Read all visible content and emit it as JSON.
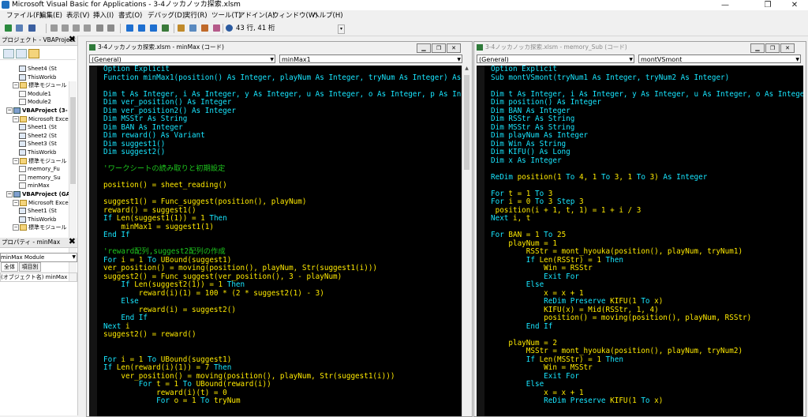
{
  "window": {
    "title": "Microsoft Visual Basic for Applications - 3-4ノッカノッカ探索.xlsm",
    "minimize": "—",
    "restore": "❐",
    "close": "✕"
  },
  "menu": [
    "ファイル(F)",
    "編集(E)",
    "表示(V)",
    "挿入(I)",
    "書式(O)",
    "デバッグ(D)",
    "実行(R)",
    "ツール(T)",
    "アドイン(A)",
    "ウィンドウ(W)",
    "ヘルプ(H)"
  ],
  "toolbar": {
    "cursor_pos": "43 行, 41 桁"
  },
  "project_pane": {
    "title": "プロジェクト - VBAProject",
    "close": "✖",
    "items": [
      {
        "label": "Sheet4 (St",
        "indent": 3,
        "icon": "sheet"
      },
      {
        "label": "ThisWorkb",
        "indent": 3,
        "icon": "sheet"
      },
      {
        "label": "標準モジュール",
        "indent": 2,
        "icon": "folder",
        "exp": "−"
      },
      {
        "label": "Module1",
        "indent": 3,
        "icon": "mod"
      },
      {
        "label": "Module2",
        "indent": 3,
        "icon": "mod"
      },
      {
        "label": "VBAProject (3-",
        "indent": 1,
        "icon": "proj",
        "exp": "−",
        "bold": true
      },
      {
        "label": "Microsoft Exce",
        "indent": 2,
        "icon": "folder",
        "exp": "−"
      },
      {
        "label": "Sheet1 (St",
        "indent": 3,
        "icon": "sheet"
      },
      {
        "label": "Sheet2 (St",
        "indent": 3,
        "icon": "sheet"
      },
      {
        "label": "Sheet3 (St",
        "indent": 3,
        "icon": "sheet"
      },
      {
        "label": "ThisWorkb",
        "indent": 3,
        "icon": "sheet"
      },
      {
        "label": "標準モジュール",
        "indent": 2,
        "icon": "folder",
        "exp": "−"
      },
      {
        "label": "memory_Fu",
        "indent": 3,
        "icon": "mod"
      },
      {
        "label": "memory_Su",
        "indent": 3,
        "icon": "mod"
      },
      {
        "label": "minMax",
        "indent": 3,
        "icon": "mod"
      },
      {
        "label": "VBAProject (GA",
        "indent": 1,
        "icon": "proj",
        "exp": "−",
        "bold": true
      },
      {
        "label": "Microsoft Exce",
        "indent": 2,
        "icon": "folder",
        "exp": "−"
      },
      {
        "label": "Sheet1 (St",
        "indent": 3,
        "icon": "sheet"
      },
      {
        "label": "ThisWorkb",
        "indent": 3,
        "icon": "sheet"
      },
      {
        "label": "標準モジュール",
        "indent": 2,
        "icon": "folder",
        "exp": "−"
      }
    ]
  },
  "properties_pane": {
    "title": "プロパティ - minMax",
    "close": "✖",
    "object": "minMax Module",
    "tab_all": "全体",
    "tab_category": "項目別",
    "row": "(オブジェクト名) minMax"
  },
  "code_window_left": {
    "title": "3-4ノッカノッカ探索.xlsm - minMax (コード)",
    "object_combo": "(General)",
    "proc_combo": "minMax1",
    "lines": [
      [
        [
          "kw",
          "Option Explicit"
        ]
      ],
      [
        [
          "kw",
          "Function minMax1(position() As Integer, playNum As Integer, tryNum As Integer) As Str"
        ]
      ],
      [],
      [
        [
          "kw",
          "Dim t As Integer, i As Integer, y As Integer, u As Integer, o As Integer, p As Integ"
        ]
      ],
      [
        [
          "kw",
          "Dim ver_position() As Integer"
        ]
      ],
      [
        [
          "kw",
          "Dim ver_position2() As Integer"
        ]
      ],
      [
        [
          "kw",
          "Dim MSStr As String"
        ]
      ],
      [
        [
          "kw",
          "Dim BAN As Integer"
        ]
      ],
      [
        [
          "kw",
          "Dim reward() As Variant"
        ]
      ],
      [
        [
          "kw",
          "Dim suggest1()"
        ]
      ],
      [
        [
          "kw",
          "Dim suggest2()"
        ]
      ],
      [],
      [
        [
          "cm",
          "'ワークシートの読み取りと初期設定"
        ]
      ],
      [],
      [
        [
          "id",
          "position() = sheet_reading()"
        ]
      ],
      [],
      [
        [
          "id",
          "suggest1() = Func_suggest(position(), playNum)"
        ]
      ],
      [
        [
          "id",
          "reward() = suggest1()"
        ]
      ],
      [
        [
          "kw",
          "If "
        ],
        [
          "id",
          "Len(suggest1(1)) = 1 "
        ],
        [
          "kw",
          "Then"
        ]
      ],
      [
        [
          "id",
          "    minMax1 = suggest1(1)"
        ]
      ],
      [
        [
          "kw",
          "End If"
        ]
      ],
      [],
      [
        [
          "cm",
          "'reward配列,suggest2配列の作成"
        ]
      ],
      [
        [
          "kw",
          "For "
        ],
        [
          "id",
          "i = 1 "
        ],
        [
          "kw",
          "To "
        ],
        [
          "id",
          "UBound(suggest1)"
        ]
      ],
      [
        [
          "id",
          "ver_position() = moving(position(), playNum, Str(suggest1(i)))"
        ]
      ],
      [
        [
          "id",
          "suggest2() = Func_suggest(ver_position(), 3 - playNum)"
        ]
      ],
      [
        [
          "kw",
          "    If "
        ],
        [
          "id",
          "Len(suggest2(1)) = 1 "
        ],
        [
          "kw",
          "Then"
        ]
      ],
      [
        [
          "id",
          "        reward(i)(1) = 100 * (2 * suggest2(1) - 3)"
        ]
      ],
      [
        [
          "kw",
          "    Else"
        ]
      ],
      [
        [
          "id",
          "        reward(i) = suggest2()"
        ]
      ],
      [
        [
          "kw",
          "    End If"
        ]
      ],
      [
        [
          "kw",
          "Next "
        ],
        [
          "id",
          "i"
        ]
      ],
      [
        [
          "id",
          "suggest2() = reward()"
        ]
      ],
      [],
      [],
      [
        [
          "kw",
          "For "
        ],
        [
          "id",
          "i = 1 "
        ],
        [
          "kw",
          "To "
        ],
        [
          "id",
          "UBound(suggest1)"
        ]
      ],
      [
        [
          "kw",
          "If "
        ],
        [
          "id",
          "Len(reward(i)(1)) = 7 "
        ],
        [
          "kw",
          "Then"
        ]
      ],
      [
        [
          "id",
          "    ver_position() = moving(position(), playNum, Str(suggest1(i)))"
        ]
      ],
      [
        [
          "kw",
          "        For "
        ],
        [
          "id",
          "t = 1 "
        ],
        [
          "kw",
          "To "
        ],
        [
          "id",
          "UBound(reward(i))"
        ]
      ],
      [
        [
          "id",
          "            reward(i)(t) = 0"
        ]
      ],
      [
        [
          "kw",
          "            For "
        ],
        [
          "id",
          "o = 1 "
        ],
        [
          "kw",
          "To "
        ],
        [
          "id",
          "tryNum"
        ]
      ]
    ]
  },
  "code_window_right": {
    "title": "3-4ノッカノッカ探索.xlsm - memory_Sub (コード)",
    "object_combo": "(General)",
    "proc_combo": "montVSmont",
    "lines": [
      [
        [
          "kw",
          "Option Explicit"
        ]
      ],
      [
        [
          "kw",
          "Sub montVSmont(tryNum1 As Integer, tryNum2 As Integer)"
        ]
      ],
      [],
      [
        [
          "kw",
          "Dim t As Integer, i As Integer, y As Integer, u As Integer, o As Integer"
        ]
      ],
      [
        [
          "kw",
          "Dim position() As Integer"
        ]
      ],
      [
        [
          "kw",
          "Dim BAN As Integer"
        ]
      ],
      [
        [
          "kw",
          "Dim RSStr As String"
        ]
      ],
      [
        [
          "kw",
          "Dim MSStr As String"
        ]
      ],
      [
        [
          "kw",
          "Dim playNum As Integer"
        ]
      ],
      [
        [
          "kw",
          "Dim Win As String"
        ]
      ],
      [
        [
          "kw",
          "Dim KIFU() As Long"
        ]
      ],
      [
        [
          "kw",
          "Dim x As Integer"
        ]
      ],
      [],
      [
        [
          "kw",
          "ReDim "
        ],
        [
          "id",
          "position(1 "
        ],
        [
          "kw",
          "To "
        ],
        [
          "id",
          "4, 1 "
        ],
        [
          "kw",
          "To "
        ],
        [
          "id",
          "3, 1 "
        ],
        [
          "kw",
          "To "
        ],
        [
          "id",
          "3) "
        ],
        [
          "kw",
          "As Integer"
        ]
      ],
      [],
      [
        [
          "kw",
          "For "
        ],
        [
          "id",
          "t = 1 "
        ],
        [
          "kw",
          "To "
        ],
        [
          "id",
          "3"
        ]
      ],
      [
        [
          "kw",
          "For "
        ],
        [
          "id",
          "i = 0 "
        ],
        [
          "kw",
          "To "
        ],
        [
          "id",
          "3 "
        ],
        [
          "kw",
          "Step "
        ],
        [
          "id",
          "3"
        ]
      ],
      [
        [
          "id",
          " position(i + 1, t, 1) = 1 + i / 3"
        ]
      ],
      [
        [
          "kw",
          "Next "
        ],
        [
          "id",
          "i, t"
        ]
      ],
      [],
      [
        [
          "kw",
          "For "
        ],
        [
          "id",
          "BAN = 1 "
        ],
        [
          "kw",
          "To "
        ],
        [
          "id",
          "25"
        ]
      ],
      [
        [
          "id",
          "    playNum = 1"
        ]
      ],
      [
        [
          "id",
          "        RSStr = mont_hyouka(position(), playNum, tryNum1)"
        ]
      ],
      [
        [
          "kw",
          "        If "
        ],
        [
          "id",
          "Len(RSStr) = 1 "
        ],
        [
          "kw",
          "Then"
        ]
      ],
      [
        [
          "id",
          "            Win = RSStr"
        ]
      ],
      [
        [
          "kw",
          "            Exit For"
        ]
      ],
      [
        [
          "kw",
          "        Else"
        ]
      ],
      [
        [
          "id",
          "            x = x + 1"
        ]
      ],
      [
        [
          "kw",
          "            ReDim Preserve "
        ],
        [
          "id",
          "KIFU(1 "
        ],
        [
          "kw",
          "To "
        ],
        [
          "id",
          "x)"
        ]
      ],
      [
        [
          "id",
          "            KIFU(x) = Mid(RSStr, 1, 4)"
        ]
      ],
      [
        [
          "id",
          "            position() = moving(position(), playNum, RSStr)"
        ]
      ],
      [
        [
          "kw",
          "        End If"
        ]
      ],
      [],
      [
        [
          "id",
          "    playNum = 2"
        ]
      ],
      [
        [
          "id",
          "        MSStr = mont_hyouka(position(), playNum, tryNum2)"
        ]
      ],
      [
        [
          "kw",
          "        If "
        ],
        [
          "id",
          "Len(MSStr) = 1 "
        ],
        [
          "kw",
          "Then"
        ]
      ],
      [
        [
          "id",
          "            Win = MSStr"
        ]
      ],
      [
        [
          "kw",
          "            Exit For"
        ]
      ],
      [
        [
          "kw",
          "        Else"
        ]
      ],
      [
        [
          "id",
          "            x = x + 1"
        ]
      ],
      [
        [
          "kw",
          "            ReDim Preserve "
        ],
        [
          "id",
          "KIFU(1 "
        ],
        [
          "kw",
          "To "
        ],
        [
          "id",
          "x)"
        ]
      ]
    ]
  },
  "colors": {
    "keyword": "#18e6ff",
    "comment": "#1ec81e",
    "identifier": "#ffea00",
    "editor_bg": "#000000"
  }
}
